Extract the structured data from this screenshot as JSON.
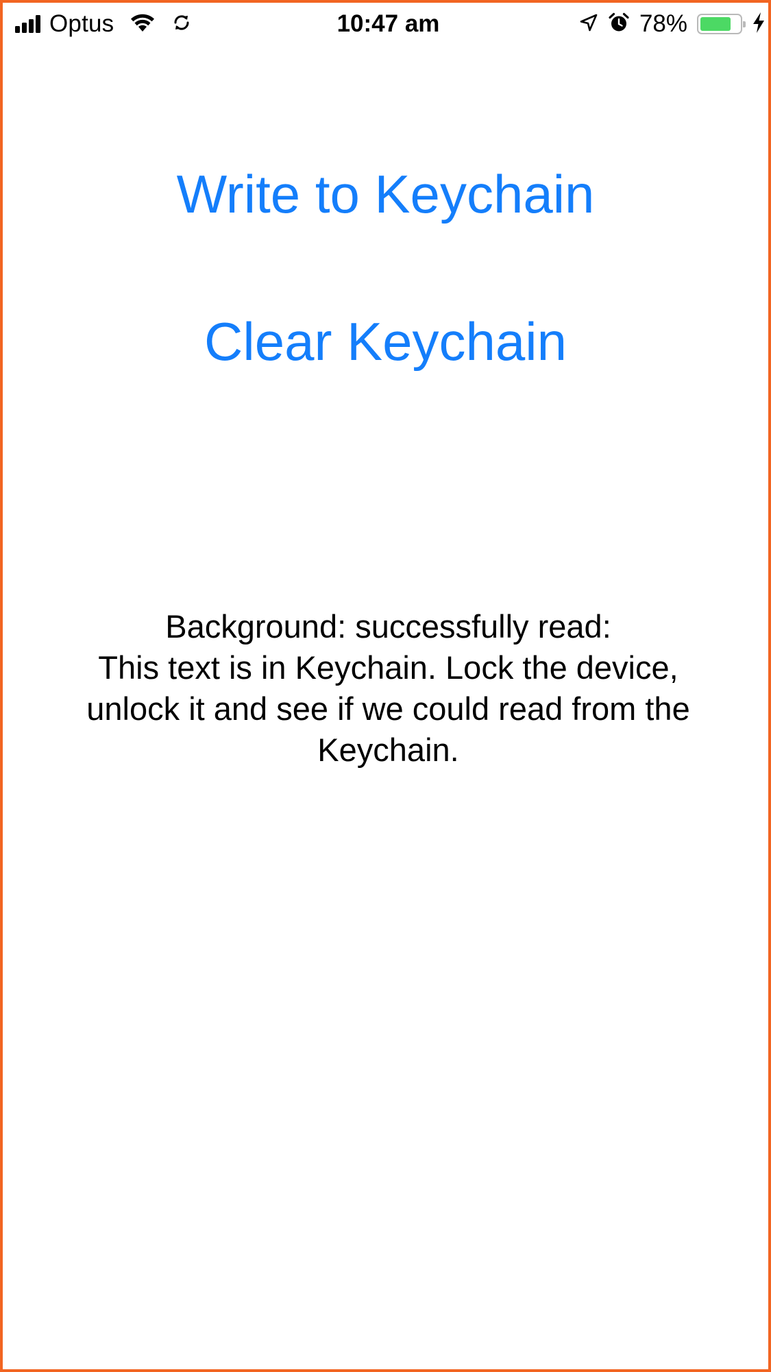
{
  "status_bar": {
    "carrier": "Optus",
    "time": "10:47 am",
    "battery_percent_label": "78%",
    "battery_level": 0.78,
    "battery_color": "#4cd964",
    "icons": [
      "signal-icon",
      "wifi-icon",
      "sync-icon",
      "location-arrow-icon",
      "alarm-icon",
      "battery-icon",
      "charging-bolt-icon"
    ]
  },
  "actions": {
    "write_label": "Write to Keychain",
    "clear_label": "Clear Keychain"
  },
  "result": {
    "line1": "Background: successfully read:",
    "line2": "This text is in Keychain. Lock the device,",
    "line3": "unlock it and see if we could read from the",
    "line4": "Keychain."
  },
  "colors": {
    "accent": "#147efb",
    "frame_border": "#f26522"
  }
}
